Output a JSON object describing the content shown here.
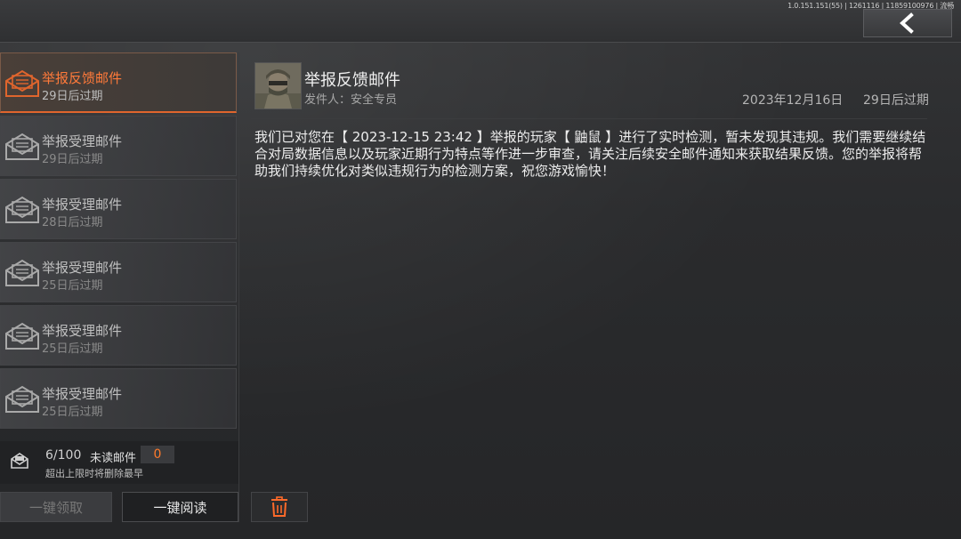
{
  "header": {
    "version_text": "1.0.151.151(55) | 1261116 | 11859100976 | 流畅",
    "back_icon": "chevron-left-icon"
  },
  "sidebar": {
    "items": [
      {
        "title": "举报反馈邮件",
        "expiry": "29日后过期",
        "active": true,
        "icon": "envelope-open-icon"
      },
      {
        "title": "举报受理邮件",
        "expiry": "29日后过期",
        "active": false,
        "icon": "envelope-open-icon"
      },
      {
        "title": "举报受理邮件",
        "expiry": "28日后过期",
        "active": false,
        "icon": "envelope-open-icon"
      },
      {
        "title": "举报受理邮件",
        "expiry": "25日后过期",
        "active": false,
        "icon": "envelope-open-icon"
      },
      {
        "title": "举报受理邮件",
        "expiry": "25日后过期",
        "active": false,
        "icon": "envelope-open-icon"
      },
      {
        "title": "举报受理邮件",
        "expiry": "25日后过期",
        "active": false,
        "icon": "envelope-open-icon"
      }
    ],
    "quota": {
      "count": "6/100",
      "unread_label": "未读邮件",
      "unread_count": "0",
      "note": "超出上限时将删除最早"
    },
    "buttons": {
      "claim_all": "一键领取",
      "read_all": "一键阅读"
    }
  },
  "detail": {
    "title": "举报反馈邮件",
    "sender_label": "发件人：安全专员",
    "date": "2023年12月16日",
    "expiry": "29日后过期",
    "body": "我们已对您在【 2023-12-15 23:42 】举报的玩家【 鼬鼠 】进行了实时检测，暂未发现其违规。我们需要继续结合对局数据信息以及玩家近期行为特点等作进一步审查，请关注后续安全邮件通知来获取结果反馈。您的举报将帮助我们持续优化对类似违规行为的检测方案，祝您游戏愉快！"
  },
  "colors": {
    "accent": "#ff7a3a",
    "active_border": "#e0652d",
    "background": "#2a2b2d"
  }
}
